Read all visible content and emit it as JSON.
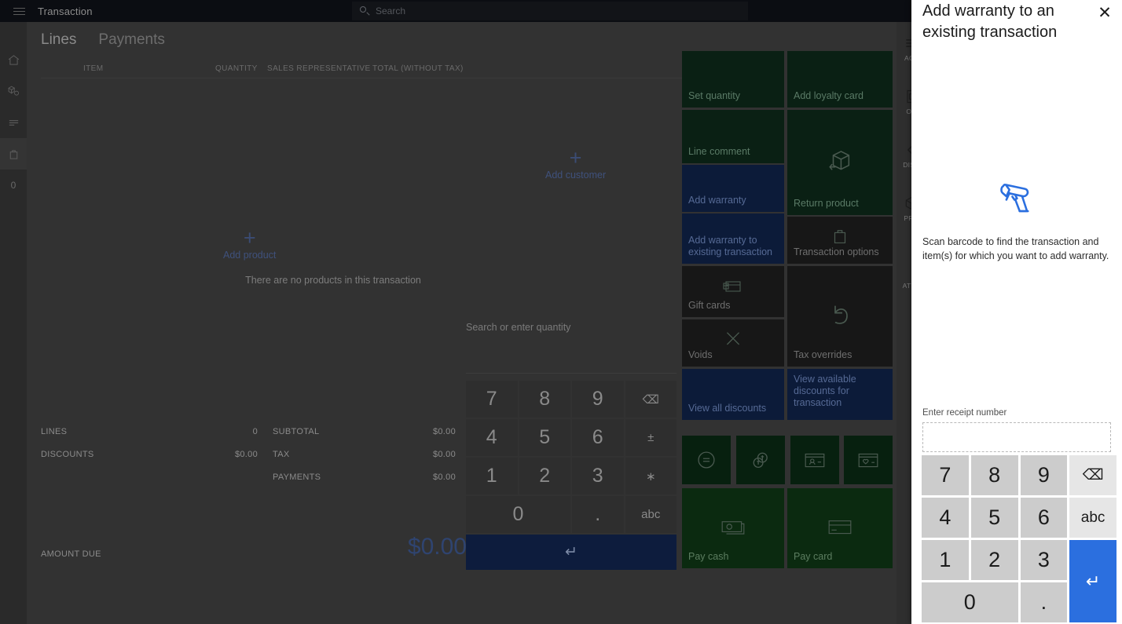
{
  "topbar": {
    "menu_icon": "hamburger-icon",
    "title": "Transaction",
    "search_icon": "search-icon",
    "search_placeholder": "Search"
  },
  "left_rail": {
    "items": [
      {
        "name": "home",
        "icon": "home-icon",
        "label": ""
      },
      {
        "name": "products",
        "icon": "cubes-icon",
        "label": ""
      },
      {
        "name": "list",
        "icon": "list-icon",
        "label": ""
      },
      {
        "name": "cart",
        "icon": "bag-icon",
        "label": ""
      },
      {
        "name": "count",
        "icon": "",
        "label": "0"
      }
    ]
  },
  "tabs": [
    {
      "label": "Lines",
      "selected": true
    },
    {
      "label": "Payments",
      "selected": false
    }
  ],
  "lines_grid": {
    "columns": [
      "ITEM",
      "QUANTITY",
      "SALES REPRESENTATIVE",
      "TOTAL (WITHOUT TAX)"
    ],
    "empty_message": "There are no products in this transaction",
    "add_product": {
      "icon": "plus-icon",
      "label": "Add product"
    },
    "add_customer": {
      "icon": "plus-icon",
      "label": "Add customer"
    }
  },
  "totals": {
    "lines_label": "LINES",
    "lines_value": "0",
    "discounts_label": "DISCOUNTS",
    "discounts_value": "$0.00",
    "subtotal_label": "SUBTOTAL",
    "subtotal_value": "$0.00",
    "tax_label": "TAX",
    "tax_value": "$0.00",
    "payments_label": "PAYMENTS",
    "payments_value": "$0.00",
    "amount_due_label": "AMOUNT DUE",
    "amount_due_value": "$0.00",
    "amount_due_color": "#2f4470"
  },
  "numpad": {
    "placeholder": "Search or enter quantity",
    "keys": [
      "7",
      "8",
      "9",
      "backspace-icon",
      "4",
      "5",
      "6",
      "±",
      "1",
      "2",
      "3",
      "∗",
      "0",
      ".",
      "abc"
    ],
    "enter_icon": "enter-icon",
    "backspace_label": "⌫",
    "enter_label": "↵"
  },
  "tiles": [
    {
      "label": "Set quantity",
      "style": "green",
      "icon": ""
    },
    {
      "label": "Add loyalty card",
      "style": "green",
      "icon": ""
    },
    {
      "label": "Line comment",
      "style": "green",
      "icon": ""
    },
    {
      "label": "Return product",
      "style": "green",
      "icon": "return-product-icon"
    },
    {
      "label": "Add warranty",
      "style": "blue",
      "icon": ""
    },
    {
      "label": "Add warranty to existing transaction",
      "style": "blue",
      "icon": ""
    },
    {
      "label": "Transaction options",
      "style": "dark",
      "icon": "bag-icon"
    },
    {
      "label": "Gift cards",
      "style": "dark",
      "icon": "gift-card-icon"
    },
    {
      "label": "Tax overrides",
      "style": "dark",
      "icon": "undo-icon"
    },
    {
      "label": "Voids",
      "style": "dark",
      "icon": "x-icon"
    },
    {
      "label": "View all discounts",
      "style": "blue",
      "icon": ""
    },
    {
      "label": "View available discounts for transaction",
      "style": "blue",
      "icon": ""
    },
    {
      "label": "",
      "style": "icononly",
      "icon": "equals-circle-icon"
    },
    {
      "label": "",
      "style": "icononly",
      "icon": "coins-icon"
    },
    {
      "label": "",
      "style": "icononly",
      "icon": "id-card-icon"
    },
    {
      "label": "",
      "style": "icononly",
      "icon": "loyalty-card-icon"
    },
    {
      "label": "Pay cash",
      "style": "green-dk",
      "icon": "cash-icon"
    },
    {
      "label": "Pay card",
      "style": "green-dk",
      "icon": "credit-card-icon"
    }
  ],
  "right_rail": {
    "items": [
      {
        "icon": "hamburger-icon",
        "label": "ACT"
      },
      {
        "icon": "receipt-icon",
        "label": "OR"
      },
      {
        "icon": "chevron-left-icon",
        "label": "DISC"
      },
      {
        "icon": "cube-icon",
        "label": "PRO"
      },
      {
        "icon": "",
        "label": "ATTR"
      }
    ]
  },
  "modal": {
    "title": "Add warranty to an existing transaction",
    "close_icon": "close-icon",
    "close_label": "✕",
    "scan_icon": "barcode-scanner-icon",
    "scan_text": "Scan barcode to find the transaction and item(s) for which you want to add warranty.",
    "receipt_label": "Enter receipt number",
    "receipt_value": "",
    "receipt_placeholder": "",
    "keypad": {
      "keys": [
        "7",
        "8",
        "9",
        "backspace",
        "4",
        "5",
        "6",
        "abc",
        "1",
        "2",
        "3",
        "enter",
        "0",
        "."
      ],
      "backspace_label": "⌫",
      "abc_label": "abc",
      "enter_label": "↵",
      "enter_color": "#2b6fdf"
    }
  }
}
